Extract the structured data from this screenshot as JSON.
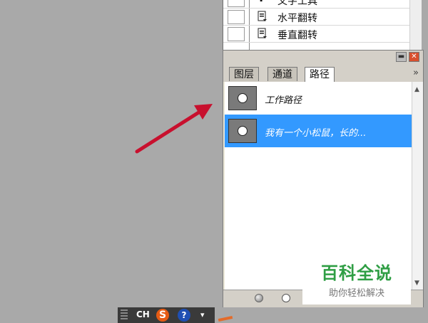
{
  "history": {
    "items": [
      {
        "label": "文字工具"
      },
      {
        "label": "水平翻转"
      },
      {
        "label": "垂直翻转"
      }
    ]
  },
  "panel": {
    "min_glyph": "▬",
    "close_glyph": "✕",
    "tabs": [
      {
        "label": "图层"
      },
      {
        "label": "通道"
      },
      {
        "label": "路径"
      }
    ],
    "more_glyph": "»",
    "paths": [
      {
        "name": "工作路径"
      },
      {
        "name": "我有一个小松鼠，长的..."
      }
    ],
    "scroll_up": "▲",
    "scroll_down": "▼"
  },
  "watermark": {
    "title": "百科全说",
    "subtitle": "助你轻松解决"
  },
  "ime": {
    "lang": "CH",
    "logo_letter": "S",
    "help": "?",
    "menu": "▾"
  },
  "colors": {
    "selection": "#3399ff",
    "arrow": "#c8102e",
    "watermark_green": "#2f9e44"
  }
}
